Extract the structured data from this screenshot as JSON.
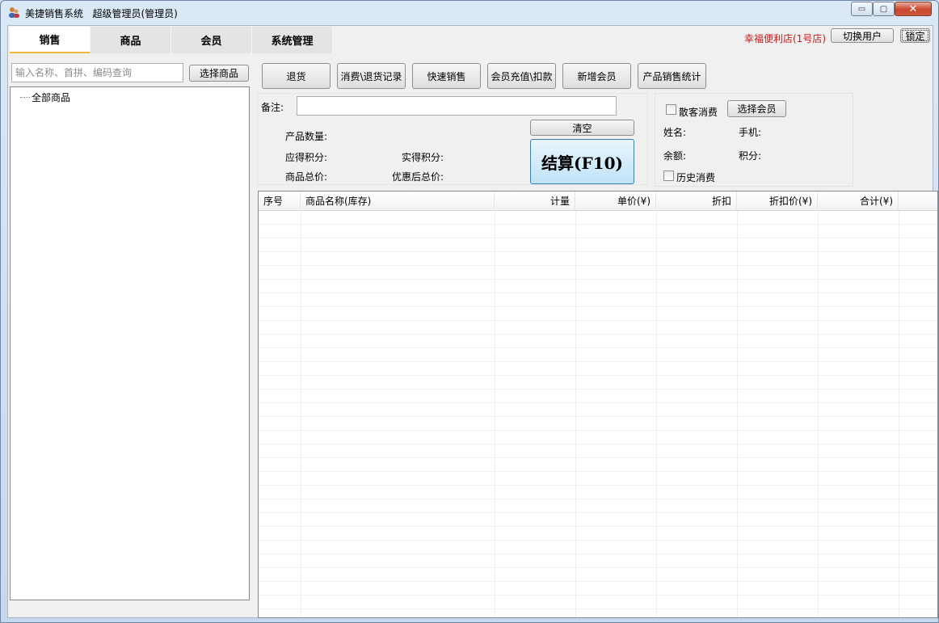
{
  "window": {
    "title": "美捷销售系统   超级管理员(管理员)",
    "minimize_glyph": "▭",
    "maximize_glyph": "▢",
    "close_glyph": "✕"
  },
  "tabs": [
    {
      "label": "销售",
      "active": true
    },
    {
      "label": "商品",
      "active": false
    },
    {
      "label": "会员",
      "active": false
    },
    {
      "label": "系统管理",
      "active": false
    }
  ],
  "header": {
    "store_name": "幸福便利店(1号店)",
    "switch_user_label": "切换用户",
    "lock_label": "锁定"
  },
  "left_panel": {
    "search_placeholder": "输入名称、首拼、编码查询",
    "choose_product_label": "选择商品",
    "tree_root": "全部商品"
  },
  "toolbar": [
    {
      "label": "退货",
      "name": "return-button"
    },
    {
      "label": "消费\\退货记录",
      "name": "consume-return-records-button"
    },
    {
      "label": "快速销售",
      "name": "quick-sale-button"
    },
    {
      "label": "会员充值\\扣款",
      "name": "member-recharge-button"
    },
    {
      "label": "新增会员",
      "name": "add-member-button"
    },
    {
      "label": "产品销售统计",
      "name": "product-sales-stats-button"
    }
  ],
  "sale_info": {
    "remark_label": "备注:",
    "remark_value": "",
    "product_qty_label": "产品数量:",
    "expected_points_label": "应得积分:",
    "actual_points_label": "实得积分:",
    "total_price_label": "商品总价:",
    "discounted_total_label": "优惠后总价:",
    "clear_label": "清空",
    "settle_label": "结算(F10)"
  },
  "member": {
    "walk_in_label": "散客消费",
    "walk_in_checked": false,
    "choose_member_label": "选择会员",
    "name_label": "姓名:",
    "phone_label": "手机:",
    "balance_label": "余额:",
    "points_label": "积分:",
    "history_label": "历史消费",
    "history_checked": false
  },
  "table": {
    "columns": [
      "序号",
      "商品名称(库存)",
      "计量",
      "单价(¥)",
      "折扣",
      "折扣价(¥)",
      "合计(¥)"
    ],
    "rows": []
  }
}
